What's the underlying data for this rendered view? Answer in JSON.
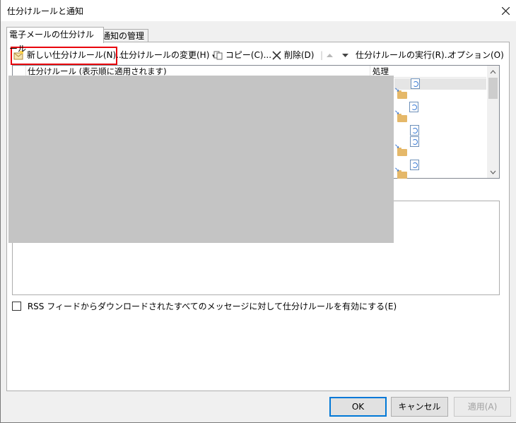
{
  "window": {
    "title": "仕分けルールと通知"
  },
  "tabs": [
    {
      "label": "電子メールの仕分けルール"
    },
    {
      "label": "通知の管理"
    }
  ],
  "toolbar": {
    "new_rule": "新しい仕分けルール(N)...",
    "change_rule": "仕分けルールの変更(H)",
    "copy": "コピー(C)...",
    "delete": "削除(D)",
    "run_rules": "仕分けルールの実行(R)...",
    "options": "オプション(O)"
  },
  "list": {
    "columns": {
      "name": "仕分けルール (表示順に適用されます)",
      "action": "処理"
    }
  },
  "rss": {
    "label": "RSS フィードからダウンロードされたすべてのメッセージに対して仕分けルールを有効にする(E)"
  },
  "buttons": {
    "ok": "OK",
    "cancel": "キャンセル",
    "apply": "適用(A)"
  },
  "colors": {
    "highlight": "#e8000c",
    "ok_border": "#0078d7",
    "folder": "#e5b869"
  },
  "icons": [
    "close-icon",
    "new-rule-icon",
    "copy-icon",
    "delete-icon",
    "move-up-icon",
    "move-down-icon",
    "folder-icon",
    "move-to-folder-icon",
    "chevron-up-icon",
    "chevron-down-icon"
  ]
}
